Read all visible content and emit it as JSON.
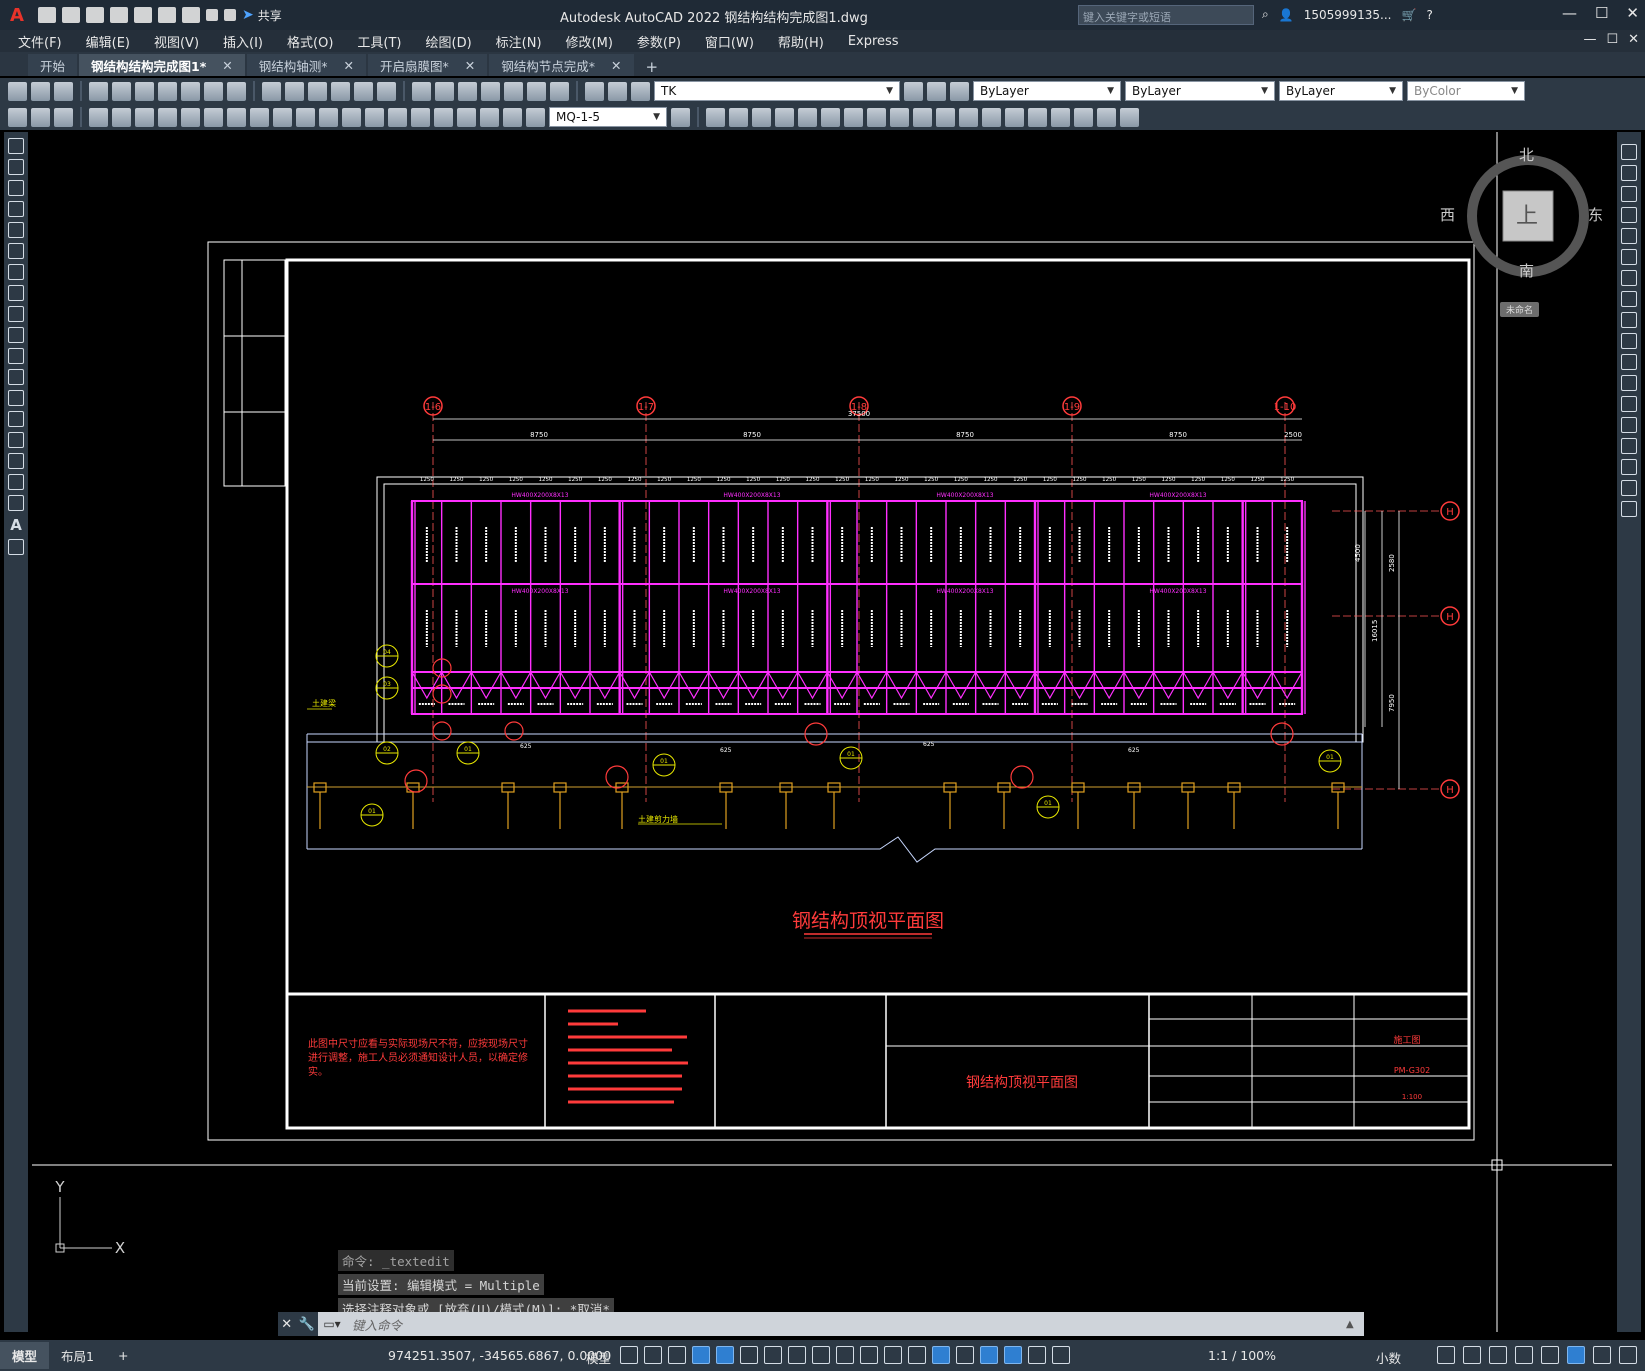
{
  "app": {
    "logo": "A",
    "title": "Autodesk AutoCAD 2022    钢结构结构完成图1.dwg",
    "share_label": "共享",
    "search_placeholder": "键入关键字或短语",
    "user": "1505999135...",
    "window_controls": [
      "—",
      "☐",
      "✕"
    ]
  },
  "menu": [
    "文件(F)",
    "编辑(E)",
    "视图(V)",
    "插入(I)",
    "格式(O)",
    "工具(T)",
    "绘图(D)",
    "标注(N)",
    "修改(M)",
    "参数(P)",
    "窗口(W)",
    "帮助(H)",
    "Express"
  ],
  "tabs": [
    {
      "label": "开始",
      "active": false,
      "closable": false
    },
    {
      "label": "钢结构结构完成图1*",
      "active": true,
      "closable": true
    },
    {
      "label": "钢结构轴测*",
      "active": false,
      "closable": true
    },
    {
      "label": "开启扇膜图*",
      "active": false,
      "closable": true
    },
    {
      "label": "钢结构节点完成*",
      "active": false,
      "closable": true
    }
  ],
  "toolbar": {
    "layer": "TK",
    "color": "ByLayer",
    "linetype": "ByLayer",
    "lineweight": "ByLayer",
    "plotstyle": "ByColor",
    "dimstyle": "MQ-1-5"
  },
  "viewcube": {
    "north": "北",
    "south": "南",
    "east": "东",
    "west": "西",
    "face": "上",
    "wcs": "未命名"
  },
  "drawing": {
    "grid_bubbles_top": [
      "1-6",
      "1-7",
      "1-8",
      "1-9",
      "1-10"
    ],
    "grid_bubbles_right": [
      "H",
      "H",
      "H"
    ],
    "overall_dim": "37500",
    "bay_dims": [
      "8750",
      "8750",
      "8750",
      "8750",
      "2500"
    ],
    "sub_dims": [
      "1250",
      "1250",
      "1250",
      "1250",
      "1250",
      "1250",
      "1250",
      "1250",
      "1250",
      "1250",
      "1250",
      "1250",
      "1250",
      "1250",
      "1250",
      "1250",
      "1250",
      "1250",
      "1250",
      "1250",
      "1250",
      "1250",
      "1250",
      "1250",
      "1250",
      "1250",
      "1250",
      "1250",
      "1250",
      "1250"
    ],
    "beam_label": "HW400X200X8X13",
    "right_dims": [
      "4500",
      "2580",
      "16015",
      "7950"
    ],
    "label_main_struct": "土建梁",
    "label_bottom": "土建剪力墙",
    "details": [
      "01",
      "02",
      "03",
      "04"
    ],
    "dim_625": "625",
    "title": "钢结构顶视平面图",
    "note": "此图中尺寸应看与实际现场尺不符，应按现场尺寸进行调整，施工人员必须通知设计人员，以确定修实。",
    "titleblock": {
      "project_title": "钢结构顶视平面图",
      "stage": "施工图",
      "drawing_no": "PM-G302",
      "scale": "1:100"
    }
  },
  "command": {
    "history": [
      "命令: _textedit",
      "当前设置: 编辑模式 = Multiple",
      "选择注释对象或 [放弃(U)/模式(M)]: *取消*"
    ],
    "placeholder": "键入命令"
  },
  "status": {
    "layout_tabs": [
      "模型",
      "布局1",
      "+"
    ],
    "coords": "974251.3507, -34565.6867, 0.0000",
    "space": "模型",
    "annotation_scale": "1:1 / 100%",
    "units": "小数"
  },
  "colors": {
    "magenta": "#ff2fff",
    "red": "#ff3b3b",
    "yellow": "#e8e800",
    "orange": "#e0a020",
    "white": "#ffffff",
    "ui_dark": "#2d3945"
  }
}
